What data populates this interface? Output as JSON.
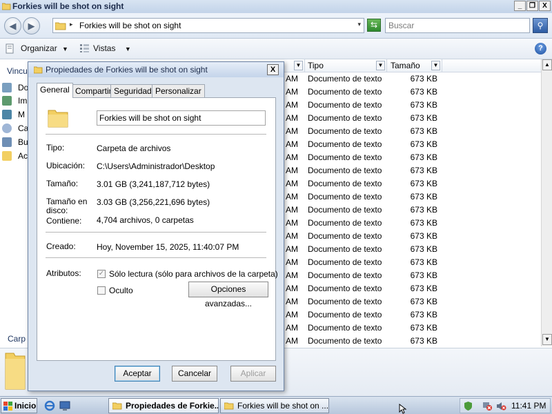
{
  "explorer": {
    "title": "Forkies will be shot on sight",
    "window_controls": {
      "minimize": "_",
      "maximize": "❐",
      "close": "X"
    },
    "address": {
      "path": "Forkies will be shot on sight",
      "separator": "▸",
      "dropdown": "▾"
    },
    "search": {
      "placeholder": "Buscar"
    },
    "toolbar": {
      "organize": "Organizar",
      "views": "Vistas",
      "help": "?"
    },
    "nav": {
      "header": "Vincu",
      "items": [
        {
          "label": "Do",
          "icon": "documents-icon"
        },
        {
          "label": "Im",
          "icon": "pictures-icon"
        },
        {
          "label": "M",
          "icon": "music-icon"
        },
        {
          "label": "Ca",
          "icon": "recent-icon"
        },
        {
          "label": "Bu",
          "icon": "search-folder-icon"
        },
        {
          "label": "Ac",
          "icon": "folder-icon"
        }
      ],
      "folders_label": "Carp"
    },
    "columns": {
      "type": "Tipo",
      "size": "Tamaño"
    },
    "rows": [
      {
        "date_suffix": "AM",
        "type": "Documento de texto",
        "size": "673 KB"
      },
      {
        "date_suffix": "AM",
        "type": "Documento de texto",
        "size": "673 KB"
      },
      {
        "date_suffix": "AM",
        "type": "Documento de texto",
        "size": "673 KB"
      },
      {
        "date_suffix": "AM",
        "type": "Documento de texto",
        "size": "673 KB"
      },
      {
        "date_suffix": "AM",
        "type": "Documento de texto",
        "size": "673 KB"
      },
      {
        "date_suffix": "AM",
        "type": "Documento de texto",
        "size": "673 KB"
      },
      {
        "date_suffix": "AM",
        "type": "Documento de texto",
        "size": "673 KB"
      },
      {
        "date_suffix": "AM",
        "type": "Documento de texto",
        "size": "673 KB"
      },
      {
        "date_suffix": "AM",
        "type": "Documento de texto",
        "size": "673 KB"
      },
      {
        "date_suffix": "AM",
        "type": "Documento de texto",
        "size": "673 KB"
      },
      {
        "date_suffix": "AM",
        "type": "Documento de texto",
        "size": "673 KB"
      },
      {
        "date_suffix": "AM",
        "type": "Documento de texto",
        "size": "673 KB"
      },
      {
        "date_suffix": "AM",
        "type": "Documento de texto",
        "size": "673 KB"
      },
      {
        "date_suffix": "AM",
        "type": "Documento de texto",
        "size": "673 KB"
      },
      {
        "date_suffix": "AM",
        "type": "Documento de texto",
        "size": "673 KB"
      },
      {
        "date_suffix": "AM",
        "type": "Documento de texto",
        "size": "673 KB"
      },
      {
        "date_suffix": "AM",
        "type": "Documento de texto",
        "size": "673 KB"
      },
      {
        "date_suffix": "AM",
        "type": "Documento de texto",
        "size": "673 KB"
      },
      {
        "date_suffix": "AM",
        "type": "Documento de texto",
        "size": "673 KB"
      },
      {
        "date_suffix": "AM",
        "type": "Documento de texto",
        "size": "673 KB"
      },
      {
        "date_suffix": "AM",
        "type": "Documento de texto",
        "size": "673 KB"
      }
    ]
  },
  "dialog": {
    "title": "Propiedades de Forkies will be shot on sight",
    "close": "X",
    "tabs": [
      "General",
      "Compartir",
      "Seguridad",
      "Personalizar"
    ],
    "name_value": "Forkies will be shot on sight",
    "props": {
      "type_label": "Tipo:",
      "type_value": "Carpeta de archivos",
      "location_label": "Ubicación:",
      "location_value": "C:\\Users\\Administrador\\Desktop",
      "size_label": "Tamaño:",
      "size_value": "3.01 GB (3,241,187,712 bytes)",
      "disk_size_label_1": "Tamaño en",
      "disk_size_label_2": "disco:",
      "disk_size_value": "3.03 GB (3,256,221,696 bytes)",
      "contains_label": "Contiene:",
      "contains_value": "4,704 archivos, 0 carpetas",
      "created_label": "Creado:",
      "created_value": "Hoy, November 15, 2025, 11:40:07 PM",
      "attributes_label": "Atributos:",
      "readonly_label": "Sólo lectura (sólo para archivos de la carpeta)",
      "readonly_checked": true,
      "hidden_label": "Oculto",
      "hidden_checked": false,
      "advanced_button": "Opciones avanzadas..."
    },
    "buttons": {
      "ok": "Aceptar",
      "cancel": "Cancelar",
      "apply": "Aplicar"
    }
  },
  "taskbar": {
    "start": "Inicio",
    "items": [
      {
        "label": "Propiedades de Forkie...",
        "active": true
      },
      {
        "label": "Forkies will be shot on ...",
        "active": false
      }
    ],
    "clock": "11:41 PM"
  },
  "colors": {
    "title_text": "#1b2a4a",
    "folder_yellow": "#f2cf62",
    "accent_blue": "#2d5ba3"
  }
}
